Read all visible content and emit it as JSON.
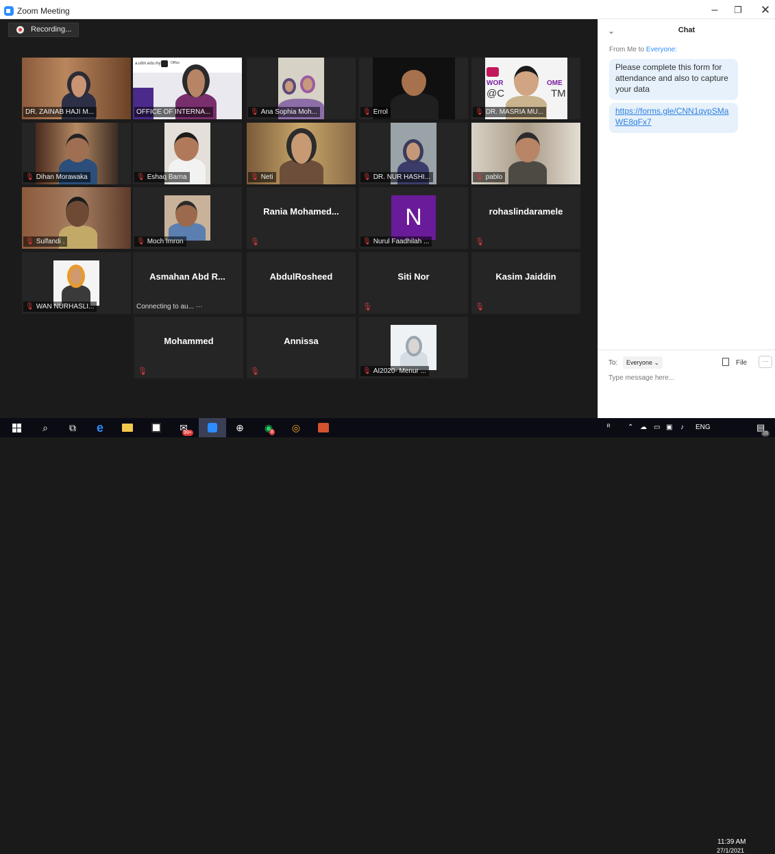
{
  "window": {
    "title": "Zoom Meeting",
    "minimize": "–",
    "maximize": "❐",
    "close": "✕"
  },
  "recording": {
    "label": "Recording..."
  },
  "tiles": [
    {
      "name": "DR. ZAINAB HAJI M..."
    },
    {
      "name": "OFFICE OF INTERNA...",
      "overlay_text": "a.uitm.edu.my",
      "overlay_office": "Office"
    },
    {
      "name": "Ana Sophia Moh..."
    },
    {
      "name": "Errol"
    },
    {
      "name": "DR. MASRIA MU...",
      "overlay_a": "WOR",
      "overlay_b": "OME",
      "overlay_c": "@C",
      "overlay_d": "TM"
    },
    {
      "name": "Dihan Morawaka"
    },
    {
      "name": "Eshaq Barna"
    },
    {
      "name": "Neti"
    },
    {
      "name": "DR. NUR HASHI..."
    },
    {
      "name": "pablo"
    },
    {
      "name": "Sulfandi ."
    },
    {
      "name": "Moch Imron"
    },
    {
      "display": "Rania  Mohamed..."
    },
    {
      "name": "Nurul Faadhilah ...",
      "avatar_letter": "N"
    },
    {
      "display": "rohaslindaramele"
    },
    {
      "name": "WAN NURHASLI..."
    },
    {
      "display": "Asmahan Abd R...",
      "status": "Connecting to au... ···"
    },
    {
      "display": "AbdulRosheed"
    },
    {
      "display": "Siti Nor"
    },
    {
      "display": "Kasim Jaiddin"
    },
    {
      "display": "Mohammed"
    },
    {
      "display": "Annissa"
    },
    {
      "name": "AI2020- Menur ..."
    }
  ],
  "chat": {
    "title": "Chat",
    "from_prefix": "From Me to ",
    "from_target": "Everyone:",
    "message1": "Please complete this form for attendance and also to capture your data",
    "message2": "https://forms.gle/CNN1qvpSMaWE8qFx7",
    "to_label": "To:",
    "to_value": "Everyone ⌄",
    "file_label": "File",
    "more_label": "···",
    "input_placeholder": "Type message here..."
  },
  "taskbar": {
    "badge_edge": "99+",
    "badge_chat": "8",
    "tray_lang": "ENG",
    "time": "11:39 AM",
    "date": "27/1/2021",
    "notif_count": "15"
  }
}
